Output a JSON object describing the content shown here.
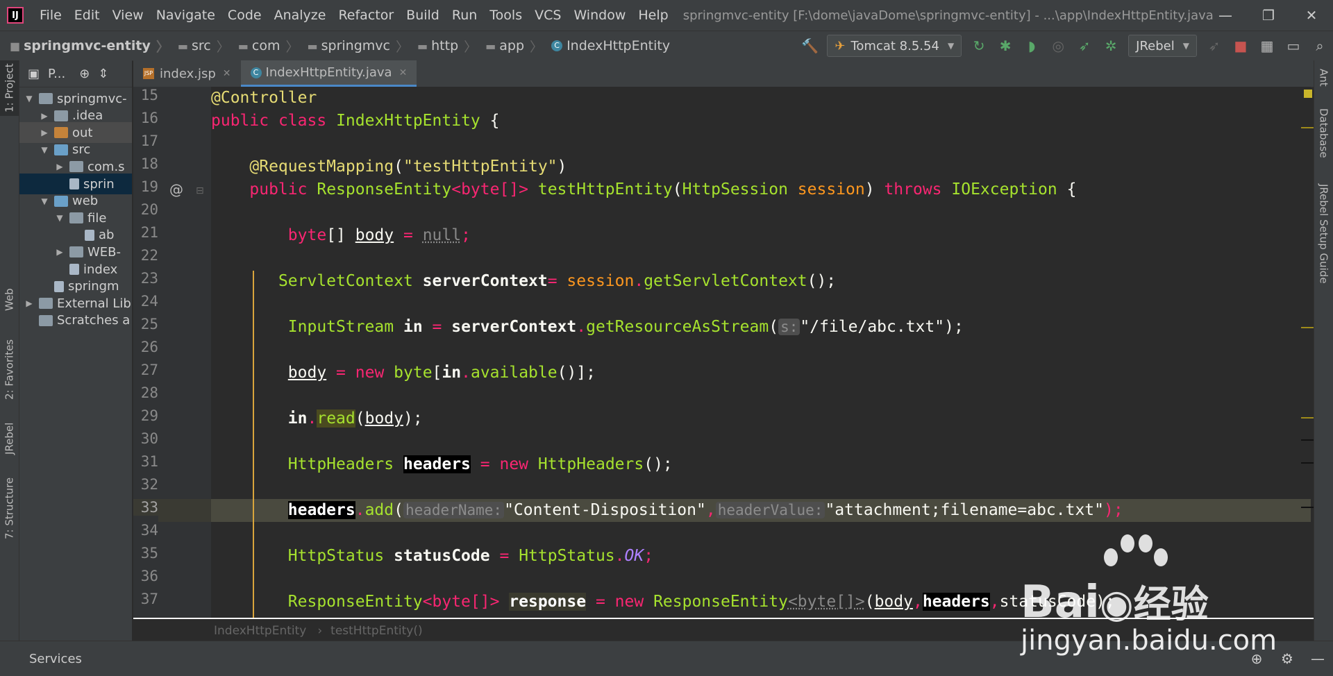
{
  "menubar": {
    "items": [
      "File",
      "Edit",
      "View",
      "Navigate",
      "Code",
      "Analyze",
      "Refactor",
      "Build",
      "Run",
      "Tools",
      "VCS",
      "Window",
      "Help"
    ],
    "title": "springmvc-entity [F:\\dome\\javaDome\\springmvc-entity] - ...\\app\\IndexHttpEntity.java"
  },
  "navbar": {
    "crumbs": [
      "springmvc-entity",
      "src",
      "com",
      "springmvc",
      "http",
      "app",
      "IndexHttpEntity"
    ],
    "run_config": "Tomcat 8.5.54",
    "jrebel": "JRebel"
  },
  "leftstrip": {
    "project": "1: Project",
    "web": "Web",
    "favorites": "2: Favorites",
    "jrebel": "JRebel",
    "structure": "7: Structure"
  },
  "rightstrip": {
    "ant": "Ant",
    "database": "Database",
    "jrebel_guide": "JRebel Setup Guide"
  },
  "project": {
    "header": "P...",
    "tree": [
      {
        "label": "springmvc-",
        "indent": 0,
        "arrow": "▼",
        "icon": "module"
      },
      {
        "label": ".idea",
        "indent": 1,
        "arrow": "▶",
        "icon": "folder"
      },
      {
        "label": "out",
        "indent": 1,
        "arrow": "▶",
        "icon": "folder-orange"
      },
      {
        "label": "src",
        "indent": 1,
        "arrow": "▼",
        "icon": "folder-blue"
      },
      {
        "label": "com.s",
        "indent": 2,
        "arrow": "▶",
        "icon": "folder"
      },
      {
        "label": "sprin",
        "indent": 2,
        "arrow": "",
        "icon": "file"
      },
      {
        "label": "web",
        "indent": 1,
        "arrow": "▼",
        "icon": "folder-blue"
      },
      {
        "label": "file",
        "indent": 2,
        "arrow": "▼",
        "icon": "folder"
      },
      {
        "label": "ab",
        "indent": 3,
        "arrow": "",
        "icon": "file"
      },
      {
        "label": "WEB-",
        "indent": 2,
        "arrow": "▶",
        "icon": "folder"
      },
      {
        "label": "index",
        "indent": 2,
        "arrow": "",
        "icon": "file"
      },
      {
        "label": "springm",
        "indent": 1,
        "arrow": "",
        "icon": "file"
      },
      {
        "label": "External Lib",
        "indent": 0,
        "arrow": "▶",
        "icon": "lib"
      },
      {
        "label": "Scratches a",
        "indent": 0,
        "arrow": "",
        "icon": "scratch"
      }
    ]
  },
  "tabs": [
    {
      "label": "index.jsp",
      "active": false
    },
    {
      "label": "IndexHttpEntity.java",
      "active": true
    }
  ],
  "editor": {
    "line_numbers": [
      "15",
      "16",
      "17",
      "18",
      "19",
      "20",
      "21",
      "22",
      "23",
      "24",
      "25",
      "26",
      "27",
      "28",
      "29",
      "30",
      "31",
      "32",
      "33",
      "34",
      "35",
      "36",
      "37"
    ],
    "current_line": "33",
    "breadcrumb": [
      "IndexHttpEntity",
      "testHttpEntity()"
    ],
    "tokens": {
      "l15_ann": "@Controller",
      "l16_public": "public",
      "l16_class": "class",
      "l16_name": "IndexHttpEntity",
      "l16_brace": " {",
      "l18_ann": "@RequestMapping",
      "l18_arg": "\"testHttpEntity\"",
      "l19_public": "public",
      "l19_type": "ResponseEntity",
      "l19_gen": "<byte[]>",
      "l19_method": "testHttpEntity",
      "l19_ptype": "HttpSession",
      "l19_param": "session",
      "l19_throws": "throws",
      "l19_exc": "IOException",
      "l19_brace": " {",
      "l21_type": "byte",
      "l21_arr": "[]",
      "l21_var": "body",
      "l21_eq": "=",
      "l21_null": "null",
      "l21_end": ";",
      "l23_type": "ServletContext",
      "l23_var": "serverContext",
      "l23_eq": "=",
      "l23_obj": "session",
      "l23_call": "getServletContext",
      "l23_end": "();",
      "l25_type": "InputStream",
      "l25_var": "in",
      "l25_eq": "=",
      "l25_obj": "serverContext",
      "l25_call": "getResourceAsStream",
      "l25_hint": "s:",
      "l25_str": "\"/file/abc.txt\"",
      "l25_end": ");",
      "l27_var": "body",
      "l27_eq": "=",
      "l27_new": "new",
      "l27_type": "byte",
      "l27_in": "in",
      "l27_call": "available",
      "l27_end": "()];",
      "l29_in": "in",
      "l29_call": "read",
      "l29_arg": "body",
      "l29_end": ");",
      "l31_type": "HttpHeaders",
      "l31_var": "headers",
      "l31_eq": "=",
      "l31_new": "new",
      "l31_ctor": "HttpHeaders",
      "l31_end": "();",
      "l33_var": "headers",
      "l33_call": "add",
      "l33_hint1": "headerName:",
      "l33_str1": "\"Content-Disposition\"",
      "l33_hint2": "headerValue:",
      "l33_str2": "\"attachment;filename=abc.txt\"",
      "l33_end": ");",
      "l35_type": "HttpStatus",
      "l35_var": "statusCode",
      "l35_eq": "=",
      "l35_cls": "HttpStatus",
      "l35_ok": "OK",
      "l35_end": ";",
      "l37_type": "ResponseEntity",
      "l37_gen": "<byte[]>",
      "l37_var": "response",
      "l37_eq": "=",
      "l37_new": "new",
      "l37_ctor": "ResponseEntity",
      "l37_gen2": "<byte[]>",
      "l37_a1": "body",
      "l37_a2": "headers",
      "l37_a3": "statusCode",
      "l37_end": ");"
    }
  },
  "services": {
    "label": "Services"
  },
  "watermark": {
    "brand": "Bai",
    "brand_suffix": "经验",
    "url": "jingyan.baidu.com"
  },
  "colors": {
    "keyword": "#f92672",
    "type": "#a6e22e",
    "string": "#e6db74",
    "param": "#fd971f"
  }
}
